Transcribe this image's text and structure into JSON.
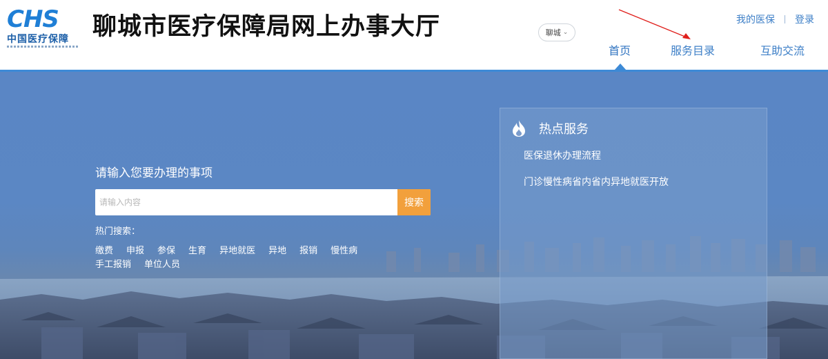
{
  "header": {
    "logo_text": "CHS",
    "logo_subtitle": "中国医疗保障",
    "site_title": "聊城市医疗保障局网上办事大厅",
    "city_select": {
      "value": "聊城"
    },
    "top_links": {
      "my_insurance": "我的医保",
      "login": "登录"
    },
    "nav": {
      "home": "首页",
      "service_catalog": "服务目录",
      "interaction": "互助交流"
    },
    "accent_color": "#3d8ad6"
  },
  "search": {
    "prompt": "请输入您要办理的事项",
    "placeholder": "请输入内容",
    "button_label": "搜索",
    "button_color": "#f2a03c",
    "hot_label": "热门搜索：",
    "hot_terms": [
      "缴费",
      "申报",
      "参保",
      "生育",
      "异地就医",
      "异地",
      "报销",
      "慢性病",
      "手工报销",
      "单位人员"
    ]
  },
  "hot_services": {
    "title": "热点服务",
    "icon": "flame-icon",
    "items": [
      "医保退休办理流程",
      "门诊慢性病省内省内异地就医开放"
    ]
  }
}
